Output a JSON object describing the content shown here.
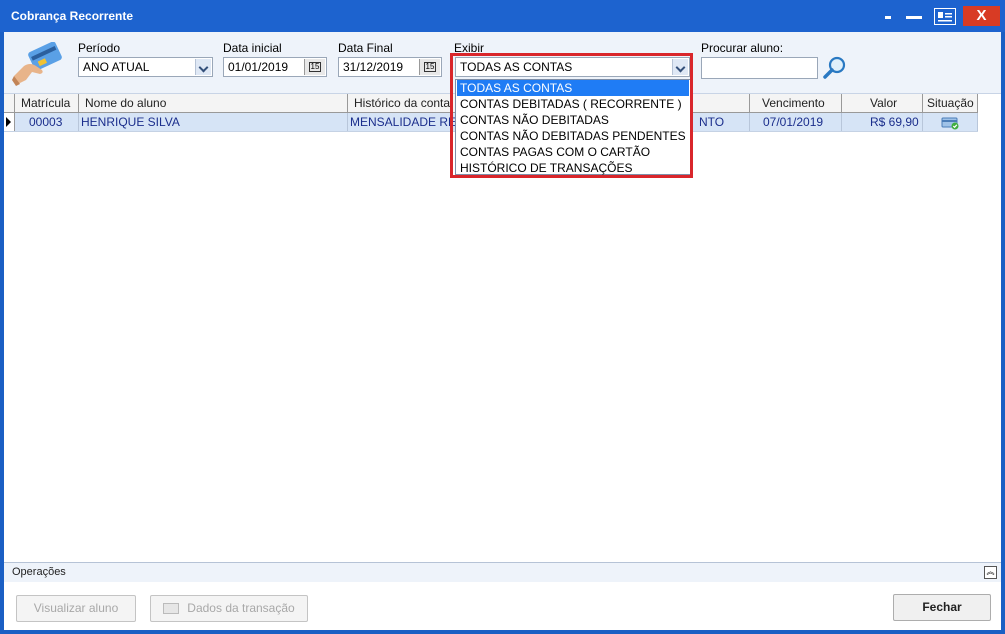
{
  "window": {
    "title": "Cobrança Recorrente",
    "close_label": "X",
    "accent_color": "#1d63cf",
    "close_color": "#d83b24"
  },
  "filters": {
    "periodo_label": "Período",
    "periodo_value": "ANO ATUAL",
    "data_inicial_label": "Data inicial",
    "data_inicial_value": "01/01/2019",
    "data_final_label": "Data Final",
    "data_final_value": "31/12/2019",
    "calendar_glyph": "15",
    "exibir_label": "Exibir",
    "exibir_value": "TODAS AS CONTAS",
    "procurar_label": "Procurar aluno:",
    "procurar_value": ""
  },
  "dropdown": {
    "options": [
      "TODAS AS CONTAS",
      "CONTAS DEBITADAS ( RECORRENTE )",
      "CONTAS NÃO DEBITADAS",
      "CONTAS NÃO DEBITADAS PENDENTES",
      "CONTAS PAGAS COM O CARTÃO",
      "HISTÓRICO DE TRANSAÇÕES"
    ],
    "selected_index": 0,
    "highlight_color": "#d9262b"
  },
  "grid": {
    "columns": [
      "Matrícula",
      "Nome do aluno",
      "Histórico da conta",
      "Vencimento",
      "Valor",
      "Situação"
    ],
    "rows": [
      {
        "matricula": "00003",
        "nome": "HENRIQUE SILVA",
        "historico": "MENSALIDADE RE",
        "historico_tail": "NTO",
        "vencimento": "07/01/2019",
        "valor": "R$ 69,90",
        "situacao_icon": "card-check-icon"
      }
    ]
  },
  "operations": {
    "label": "Operações",
    "visualizar_label": "Visualizar aluno",
    "dados_label": "Dados da transação",
    "fechar_label": "Fechar"
  }
}
